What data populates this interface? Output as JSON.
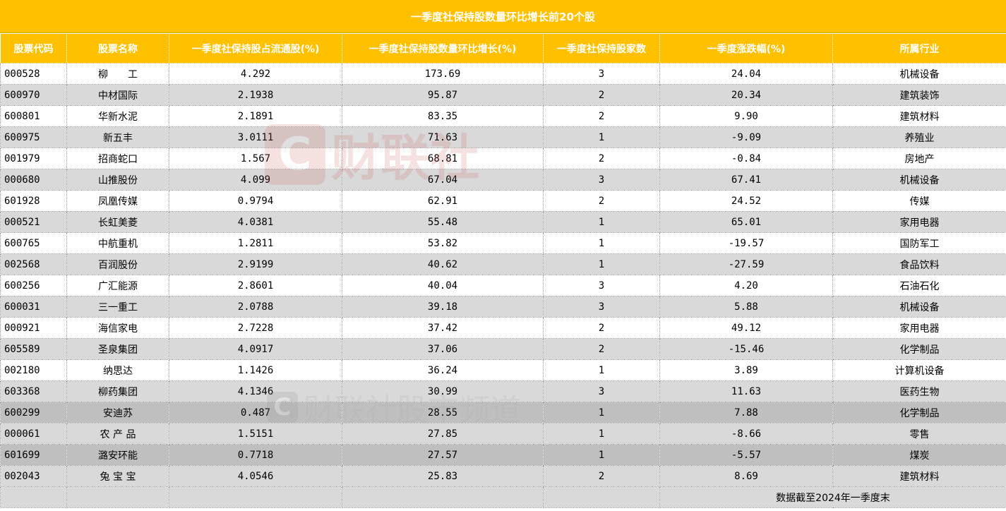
{
  "title": "一季度社保持股数量环比增长前20个股",
  "headers": [
    "股票代码",
    "股票名称",
    "一季度社保持股占流通股(%)",
    "一季度社保持股数量环比增长(%)",
    "一季度社保持股家数",
    "一季度涨跌幅(%)",
    "所属行业"
  ],
  "rows": [
    {
      "code": "000528",
      "name": "柳　　工",
      "pct_float": "4.292",
      "growth": "173.69",
      "count": "3",
      "change": "24.04",
      "industry": "机械设备"
    },
    {
      "code": "600970",
      "name": "中材国际",
      "pct_float": "2.1938",
      "growth": "95.87",
      "count": "2",
      "change": "20.34",
      "industry": "建筑装饰"
    },
    {
      "code": "600801",
      "name": "华新水泥",
      "pct_float": "2.1891",
      "growth": "83.35",
      "count": "2",
      "change": "9.90",
      "industry": "建筑材料"
    },
    {
      "code": "600975",
      "name": "新五丰",
      "pct_float": "3.0111",
      "growth": "71.63",
      "count": "1",
      "change": "-9.09",
      "industry": "养殖业"
    },
    {
      "code": "001979",
      "name": "招商蛇口",
      "pct_float": "1.567",
      "growth": "68.81",
      "count": "2",
      "change": "-0.84",
      "industry": "房地产"
    },
    {
      "code": "000680",
      "name": "山推股份",
      "pct_float": "4.099",
      "growth": "67.04",
      "count": "3",
      "change": "67.41",
      "industry": "机械设备"
    },
    {
      "code": "601928",
      "name": "凤凰传媒",
      "pct_float": "0.9794",
      "growth": "62.91",
      "count": "2",
      "change": "24.52",
      "industry": "传媒"
    },
    {
      "code": "000521",
      "name": "长虹美菱",
      "pct_float": "4.0381",
      "growth": "55.48",
      "count": "1",
      "change": "65.01",
      "industry": "家用电器"
    },
    {
      "code": "600765",
      "name": "中航重机",
      "pct_float": "1.2811",
      "growth": "53.82",
      "count": "1",
      "change": "-19.57",
      "industry": "国防军工"
    },
    {
      "code": "002568",
      "name": "百润股份",
      "pct_float": "2.9199",
      "growth": "40.62",
      "count": "1",
      "change": "-27.59",
      "industry": "食品饮料"
    },
    {
      "code": "600256",
      "name": "广汇能源",
      "pct_float": "2.8601",
      "growth": "40.04",
      "count": "3",
      "change": "4.20",
      "industry": "石油石化"
    },
    {
      "code": "600031",
      "name": "三一重工",
      "pct_float": "2.0788",
      "growth": "39.18",
      "count": "3",
      "change": "5.88",
      "industry": "机械设备"
    },
    {
      "code": "000921",
      "name": "海信家电",
      "pct_float": "2.7228",
      "growth": "37.42",
      "count": "2",
      "change": "49.12",
      "industry": "家用电器"
    },
    {
      "code": "605589",
      "name": "圣泉集团",
      "pct_float": "4.0917",
      "growth": "37.06",
      "count": "2",
      "change": "-15.46",
      "industry": "化学制品"
    },
    {
      "code": "002180",
      "name": "纳思达",
      "pct_float": "1.1426",
      "growth": "36.24",
      "count": "1",
      "change": "3.89",
      "industry": "计算机设备"
    },
    {
      "code": "603368",
      "name": "柳药集团",
      "pct_float": "4.1346",
      "growth": "30.99",
      "count": "3",
      "change": "11.63",
      "industry": "医药生物"
    },
    {
      "code": "600299",
      "name": "安迪苏",
      "pct_float": "0.487",
      "growth": "28.55",
      "count": "1",
      "change": "7.88",
      "industry": "化学制品"
    },
    {
      "code": "000061",
      "name": "农 产 品",
      "pct_float": "1.5151",
      "growth": "27.85",
      "count": "1",
      "change": "-8.66",
      "industry": "零售"
    },
    {
      "code": "601699",
      "name": "潞安环能",
      "pct_float": "0.7718",
      "growth": "27.57",
      "count": "1",
      "change": "-5.57",
      "industry": "煤炭"
    },
    {
      "code": "002043",
      "name": "兔 宝 宝",
      "pct_float": "4.0546",
      "growth": "25.83",
      "count": "2",
      "change": "8.69",
      "industry": "建筑材料"
    }
  ],
  "footnote": "数据截至2024年一季度末",
  "watermark": {
    "logo_letter": "C",
    "big_text": "财联社",
    "small_text": "财联社股市频道"
  },
  "colors": {
    "header_bg": "#FFC000",
    "header_text": "#FFFFFF",
    "alt_row": "#D9D9D9",
    "dark_row": "#BFBFBF"
  }
}
